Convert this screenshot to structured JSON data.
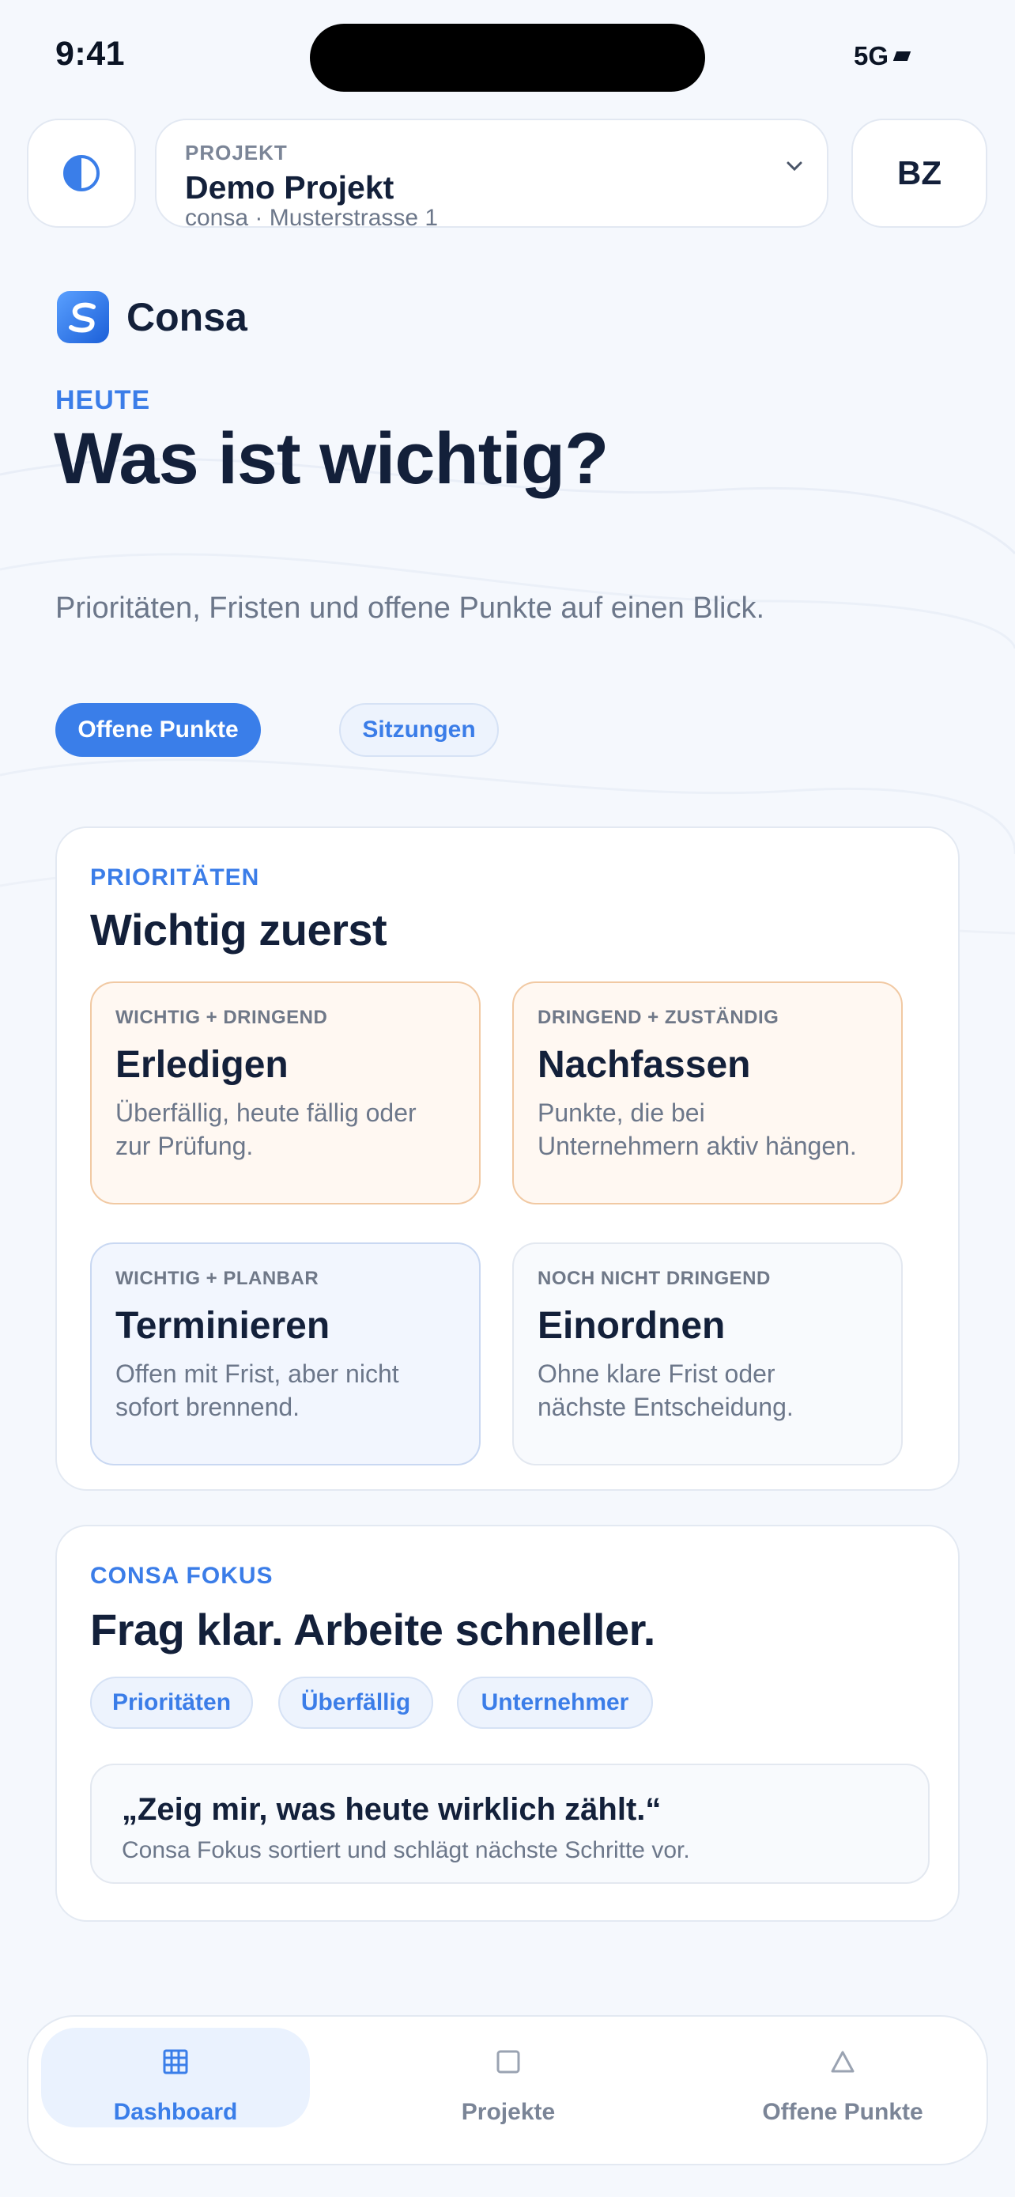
{
  "status_bar": {
    "time": "9:41",
    "network": "5G"
  },
  "header": {
    "project_label": "PROJEKT",
    "project_name": "Demo Projekt",
    "project_sub": "consa · Musterstrasse 1",
    "user_initials": "BZ"
  },
  "brand": {
    "name": "Consa"
  },
  "hero": {
    "eyebrow": "HEUTE",
    "title": "Was ist wichtig?",
    "subtitle": "Prioritäten, Fristen und offene Punkte auf einen Blick."
  },
  "filter_chips": [
    {
      "label": "Offene Punkte",
      "active": true
    },
    {
      "label": "Sitzungen",
      "active": false
    }
  ],
  "priorities": {
    "label": "PRIORITÄTEN",
    "title": "Wichtig zuerst",
    "quadrants": [
      {
        "tag": "WICHTIG + DRINGEND",
        "title": "Erledigen",
        "desc1": "Überfällig, heute fällig oder",
        "desc2": "zur Prüfung."
      },
      {
        "tag": "DRINGEND + ZUSTÄNDIG",
        "title": "Nachfassen",
        "desc1": "Punkte, die bei",
        "desc2": "Unternehmern aktiv hängen."
      },
      {
        "tag": "WICHTIG + PLANBAR",
        "title": "Terminieren",
        "desc1": "Offen mit Frist, aber nicht",
        "desc2": "sofort brennend."
      },
      {
        "tag": "NOCH NICHT DRINGEND",
        "title": "Einordnen",
        "desc1": "Ohne klare Frist oder",
        "desc2": "nächste Entscheidung."
      }
    ]
  },
  "focus": {
    "label": "CONSA FOKUS",
    "title": "Frag klar. Arbeite schneller.",
    "tags": [
      "Prioritäten",
      "Überfällig",
      "Unternehmer"
    ],
    "quote": "„Zeig mir, was heute wirklich zählt.“",
    "quote_sub": "Consa Fokus sortiert und schlägt nächste Schritte vor."
  },
  "bottom_nav": [
    {
      "label": "Dashboard",
      "icon": "grid-icon",
      "active": true
    },
    {
      "label": "Projekte",
      "icon": "square-icon",
      "active": false
    },
    {
      "label": "Offene Punkte",
      "icon": "triangle-icon",
      "active": false
    }
  ],
  "colors": {
    "accent": "#3a7ee9",
    "text": "#13203a",
    "muted": "#6c778a",
    "orange_border": "#f1c9a3",
    "blue_border": "#c9d8f2"
  }
}
